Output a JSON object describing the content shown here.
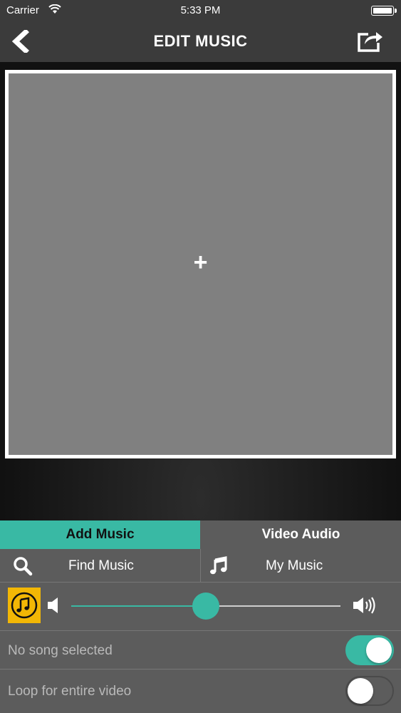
{
  "status_bar": {
    "carrier": "Carrier",
    "time": "5:33 PM",
    "wifi_icon": "wifi-icon",
    "battery_icon": "battery-icon"
  },
  "nav": {
    "title": "EDIT MUSIC",
    "back_icon": "chevron-left-icon",
    "share_icon": "share-icon"
  },
  "canvas": {
    "plus": "+"
  },
  "tabs": [
    {
      "label": "Add Music",
      "active": true
    },
    {
      "label": "Video Audio",
      "active": false
    }
  ],
  "sources": {
    "find": {
      "label": "Find Music",
      "icon": "search-icon"
    },
    "mine": {
      "label": "My Music",
      "icon": "music-note-icon"
    }
  },
  "volume": {
    "value": 0.5,
    "min_icon": "speaker-low-icon",
    "max_icon": "speaker-high-icon"
  },
  "toggles": [
    {
      "label": "No song selected",
      "on": true
    },
    {
      "label": "Loop for entire video",
      "on": false
    }
  ],
  "colors": {
    "accent": "#39b9a4",
    "panel": "#5c5c5c",
    "bar": "#3b3b3b",
    "canvas": "#808080",
    "music_tile": "#f2b705"
  }
}
